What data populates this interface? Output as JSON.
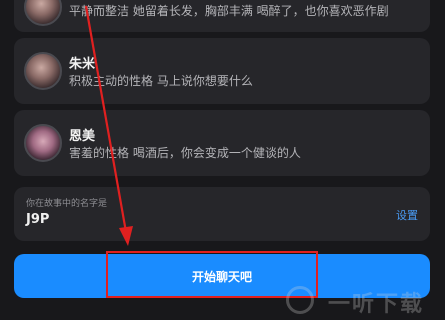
{
  "characters": [
    {
      "name": "",
      "description": "平静而整洁 她留着长发，胸部丰满 喝醉了，也你喜欢恶作剧"
    },
    {
      "name": "朱米",
      "description": "积极主动的性格 马上说你想要什么"
    },
    {
      "name": "恩美",
      "description": "害羞的性格 喝酒后，你会变成一个健谈的人"
    }
  ],
  "story_name": {
    "label": "你在故事中的名字是",
    "value": "J9P",
    "settings_label": "设置"
  },
  "start_button": {
    "label": "开始聊天吧"
  },
  "watermark": {
    "text": "一听下载"
  },
  "colors": {
    "background": "#18181b",
    "card": "#26262a",
    "accent": "#1a8cff",
    "annotation": "#e02020"
  },
  "icons": [
    "avatar-image",
    "arrow-annotation",
    "watermark-logo"
  ]
}
